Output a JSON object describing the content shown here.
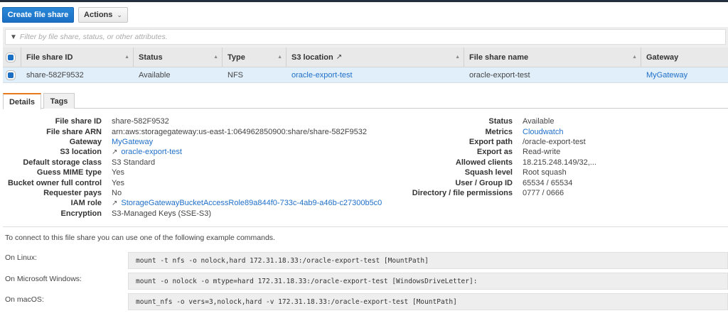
{
  "toolbar": {
    "create_label": "Create file share",
    "actions_label": "Actions"
  },
  "filter": {
    "placeholder": "Filter by file share, status, or other attributes."
  },
  "table": {
    "columns": [
      "File share ID",
      "Status",
      "Type",
      "S3 location",
      "File share name",
      "Gateway"
    ],
    "rows": [
      {
        "id": "share-582F9532",
        "status": "Available",
        "type": "NFS",
        "s3": "oracle-export-test",
        "name": "oracle-export-test",
        "gateway": "MyGateway"
      }
    ]
  },
  "tabs": [
    "Details",
    "Tags"
  ],
  "details_left": [
    {
      "k": "File share ID",
      "v": "share-582F9532"
    },
    {
      "k": "File share ARN",
      "v": "arn:aws:storagegateway:us-east-1:064962850900:share/share-582F9532"
    },
    {
      "k": "Gateway",
      "v": "MyGateway"
    },
    {
      "k": "S3 location",
      "v": "oracle-export-test"
    },
    {
      "k": "Default storage class",
      "v": "S3 Standard"
    },
    {
      "k": "Guess MIME type",
      "v": "Yes"
    },
    {
      "k": "Bucket owner full control",
      "v": "Yes"
    },
    {
      "k": "Requester pays",
      "v": "No"
    },
    {
      "k": "IAM role",
      "v": "StorageGatewayBucketAccessRole89a844f0-733c-4ab9-a46b-c27300b5c0"
    },
    {
      "k": "Encryption",
      "v": "S3-Managed Keys (SSE-S3)"
    }
  ],
  "details_right": [
    {
      "k": "Status",
      "v": "Available"
    },
    {
      "k": "Metrics",
      "v": "Cloudwatch"
    },
    {
      "k": "Export path",
      "v": "/oracle-export-test"
    },
    {
      "k": "Export as",
      "v": "Read-write"
    },
    {
      "k": "Allowed clients",
      "v": "18.215.248.149/32,..."
    },
    {
      "k": "Squash level",
      "v": "Root squash"
    },
    {
      "k": "User / Group ID",
      "v": "65534 / 65534"
    },
    {
      "k": "Directory / file permissions",
      "v": "0777 / 0666"
    }
  ],
  "connect": {
    "intro": "To connect to this file share you can use one of the following example commands.",
    "commands": [
      {
        "label": "On Linux:",
        "cmd": "mount -t nfs -o nolock,hard 172.31.18.33:/oracle-export-test [MountPath]"
      },
      {
        "label": "On Microsoft Windows:",
        "cmd": "mount -o nolock -o mtype=hard 172.31.18.33:/oracle-export-test [WindowsDriveLetter]:"
      },
      {
        "label": "On macOS:",
        "cmd": "mount_nfs -o vers=3,nolock,hard -v 172.31.18.33:/oracle-export-test [MountPath]"
      }
    ]
  }
}
